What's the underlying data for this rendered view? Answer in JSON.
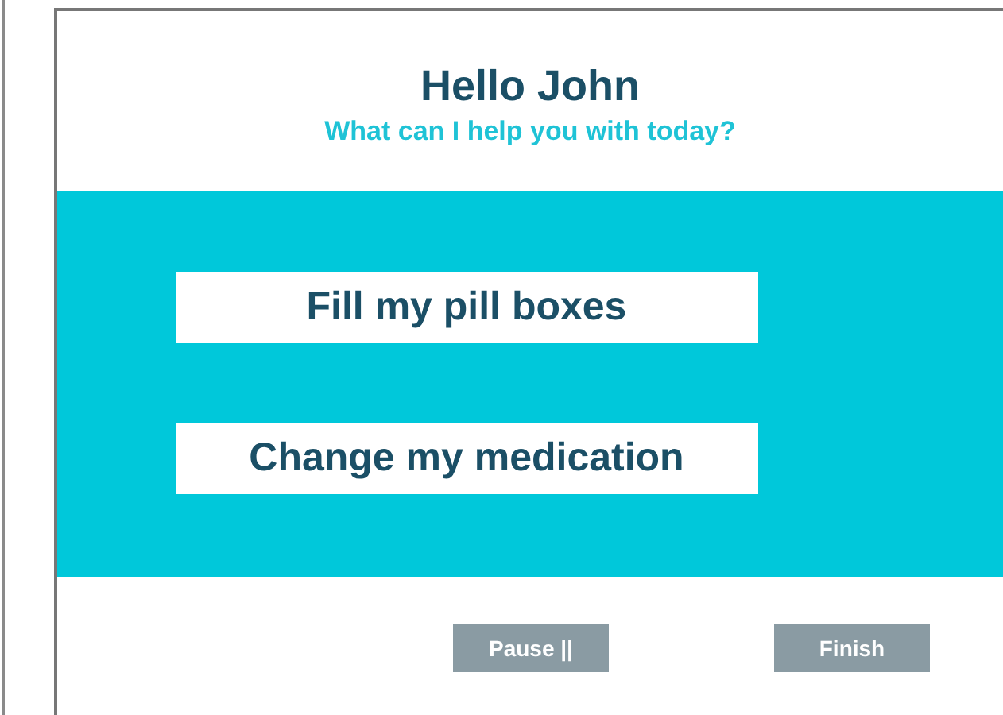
{
  "greeting": {
    "title": "Hello John",
    "subtitle": "What can I help you with today?"
  },
  "options": [
    {
      "label": "Fill my pill boxes"
    },
    {
      "label": "Change my medication"
    }
  ],
  "footer_buttons": [
    {
      "label": "Pause ||",
      "disabled": true
    },
    {
      "label": "Finish",
      "disabled": true
    }
  ]
}
